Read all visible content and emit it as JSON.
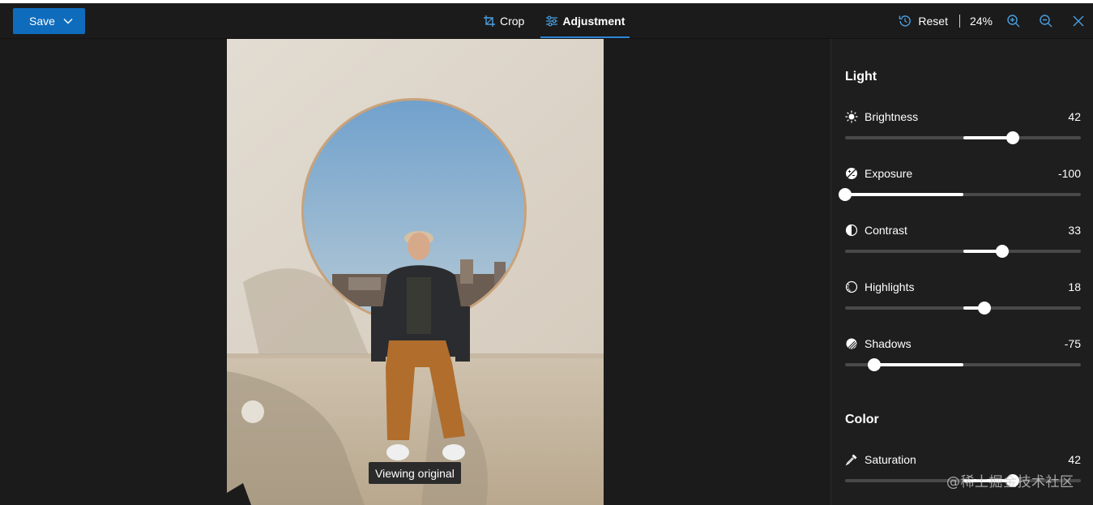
{
  "toolbar": {
    "save_label": "Save",
    "tabs": [
      {
        "label": "Crop",
        "icon": "crop-icon",
        "active": false
      },
      {
        "label": "Adjustment",
        "icon": "adjustment-sliders-icon",
        "active": true
      }
    ],
    "reset_label": "Reset",
    "zoom_level": "24%",
    "accent_color": "#0f6cbd",
    "active_tab_underline_color": "#2b88d8"
  },
  "canvas": {
    "viewing_badge": "Viewing original"
  },
  "panel": {
    "sections": [
      {
        "title": "Light",
        "settings": [
          {
            "label": "Brightness",
            "icon": "brightness-icon",
            "value": "42"
          },
          {
            "label": "Exposure",
            "icon": "exposure-icon",
            "value": "-100"
          },
          {
            "label": "Contrast",
            "icon": "contrast-icon",
            "value": "33"
          },
          {
            "label": "Highlights",
            "icon": "highlights-icon",
            "value": "18"
          },
          {
            "label": "Shadows",
            "icon": "shadows-icon",
            "value": "-75"
          }
        ]
      },
      {
        "title": "Color",
        "settings": [
          {
            "label": "Saturation",
            "icon": "eyedropper-icon",
            "value": "42"
          }
        ]
      }
    ],
    "slider_range": [
      -100,
      100
    ]
  },
  "watermark": "@稀土掘金技术社区"
}
